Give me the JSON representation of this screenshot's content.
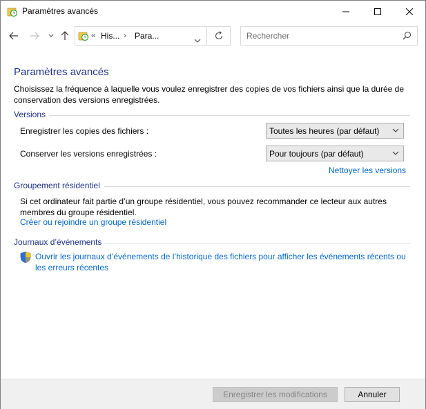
{
  "window": {
    "title": "Paramètres avancés"
  },
  "address": {
    "segments": [
      "His...",
      "Para..."
    ],
    "prefix": "«",
    "separator": "›"
  },
  "search": {
    "placeholder": "Rechercher"
  },
  "main": {
    "title": "Paramètres avancés",
    "description": "Choisissez la fréquence à laquelle vous voulez enregistrer des copies de vos fichiers ainsi que la durée de conservation des versions enregistrées."
  },
  "versions": {
    "heading": "Versions",
    "save_label": "Enregistrer les copies des fichiers :",
    "save_value": "Toutes les heures (par défaut)",
    "keep_label": "Conserver les versions enregistrées :",
    "keep_value": "Pour toujours (par défaut)",
    "cleanup_link": "Nettoyer les versions"
  },
  "homegroup": {
    "heading": "Groupement résidentiel",
    "text": "Si cet ordinateur fait partie d’un groupe résidentiel, vous pouvez recommander ce lecteur aux autres membres du groupe résidentiel.",
    "link": "Créer ou rejoindre un groupe résidentiel"
  },
  "events": {
    "heading": "Journaux d’événements",
    "link": "Ouvrir les journaux d’événements de l’historique des fichiers pour afficher les événements récents ou les erreurs récentes"
  },
  "footer": {
    "save_button": "Enregistrer les modifications",
    "cancel_button": "Annuler"
  },
  "colors": {
    "heading": "#1e3287",
    "link": "#0066cc",
    "disabled_text": "#838383"
  }
}
